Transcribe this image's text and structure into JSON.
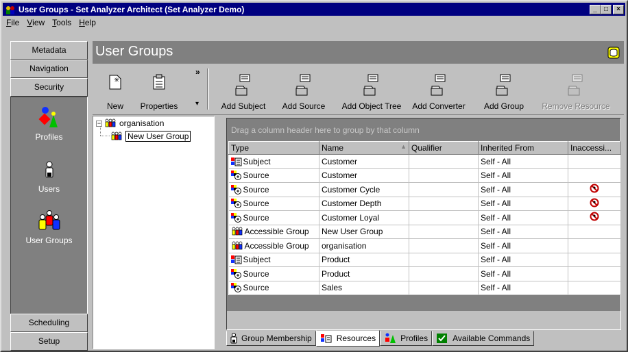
{
  "window": {
    "title": "User Groups - Set Analyzer Architect (Set Analyzer Demo)"
  },
  "menu": [
    {
      "label": "File",
      "accel": "F",
      "rest": "ile"
    },
    {
      "label": "View",
      "accel": "V",
      "rest": "iew"
    },
    {
      "label": "Tools",
      "accel": "T",
      "rest": "ools"
    },
    {
      "label": "Help",
      "accel": "H",
      "rest": "elp"
    }
  ],
  "nav": {
    "top_buttons": [
      "Metadata",
      "Navigation",
      "Security"
    ],
    "items": [
      {
        "label": "Profiles",
        "icon": "profiles-icon"
      },
      {
        "label": "Users",
        "icon": "user-icon"
      },
      {
        "label": "User Groups",
        "icon": "user-groups-icon"
      }
    ],
    "bottom_buttons": [
      "Scheduling",
      "Setup"
    ]
  },
  "header": {
    "title": "User Groups"
  },
  "toolbar": {
    "new_label": "New",
    "properties_label": "Properties",
    "more_glyph": "»",
    "dropdown_glyph": "▾",
    "add_subject": "Add Subject",
    "add_source": "Add Source",
    "add_object_tree": "Add Object Tree",
    "add_converter": "Add Converter",
    "add_group": "Add Group",
    "remove_resource": "Remove Resource"
  },
  "tree": {
    "root": "organisation",
    "child": "New User Group"
  },
  "grid": {
    "group_hint": "Drag a column header here to group by that column",
    "columns": [
      "Type",
      "Name",
      "Qualifier",
      "Inherited From",
      "Inaccessi..."
    ],
    "rows": [
      {
        "type": "Subject",
        "icon": "subject",
        "name": "Customer",
        "qualifier": "",
        "inherited": "Self - All",
        "inaccessible": false
      },
      {
        "type": "Source",
        "icon": "source",
        "name": "Customer",
        "qualifier": "",
        "inherited": "Self - All",
        "inaccessible": false
      },
      {
        "type": "Source",
        "icon": "source",
        "name": "Customer Cycle",
        "qualifier": "",
        "inherited": "Self - All",
        "inaccessible": true
      },
      {
        "type": "Source",
        "icon": "source",
        "name": "Customer Depth",
        "qualifier": "",
        "inherited": "Self - All",
        "inaccessible": true
      },
      {
        "type": "Source",
        "icon": "source",
        "name": "Customer Loyal",
        "qualifier": "",
        "inherited": "Self - All",
        "inaccessible": true
      },
      {
        "type": "Accessible Group",
        "icon": "group",
        "name": "New User Group",
        "qualifier": "",
        "inherited": "Self - All",
        "inaccessible": false
      },
      {
        "type": "Accessible Group",
        "icon": "group",
        "name": "organisation",
        "qualifier": "",
        "inherited": "Self - All",
        "inaccessible": false
      },
      {
        "type": "Subject",
        "icon": "subject",
        "name": "Product",
        "qualifier": "",
        "inherited": "Self - All",
        "inaccessible": false
      },
      {
        "type": "Source",
        "icon": "source",
        "name": "Product",
        "qualifier": "",
        "inherited": "Self - All",
        "inaccessible": false
      },
      {
        "type": "Source",
        "icon": "source",
        "name": "Sales",
        "qualifier": "",
        "inherited": "Self - All",
        "inaccessible": false
      }
    ]
  },
  "tabs": [
    {
      "label": "Group Membership",
      "icon": "user-icon",
      "active": false
    },
    {
      "label": "Resources",
      "icon": "resources-icon",
      "active": true
    },
    {
      "label": "Profiles",
      "icon": "profiles-icon",
      "active": false
    },
    {
      "label": "Available Commands",
      "icon": "checkmark-icon",
      "active": false
    }
  ],
  "colors": {
    "title_bar": "#000080",
    "nav_panel": "#808080",
    "face": "#c0c0c0",
    "selection": "#000080"
  }
}
